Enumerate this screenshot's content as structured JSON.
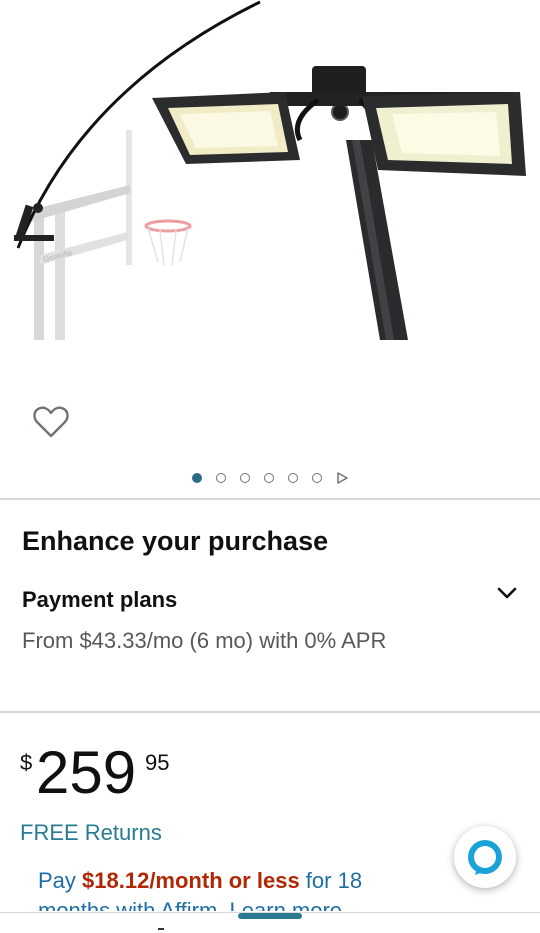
{
  "carousel": {
    "total_images": 6,
    "active_index": 0
  },
  "enhance": {
    "heading": "Enhance your purchase"
  },
  "payment_plans": {
    "title": "Payment plans",
    "description": "From $43.33/mo (6 mo) with 0% APR",
    "chevron_icon": "chevron-down-icon"
  },
  "price": {
    "symbol": "$",
    "whole": "259",
    "fraction": "95"
  },
  "free_returns": "FREE Returns",
  "affirm": {
    "prefix": "Pay ",
    "amount": "$18.12/month or less",
    "suffix": " for 18",
    "line2": "months with Affirm. Learn more"
  },
  "icons": {
    "wishlist": "heart-outline-icon",
    "assistant": "alexa-ring-icon",
    "carousel_next": "play-triangle-icon"
  },
  "colors": {
    "link": "#2a7a91",
    "price_highlight": "#b12704",
    "active_dot": "#2c6b84",
    "divider": "#d5d9d9"
  }
}
